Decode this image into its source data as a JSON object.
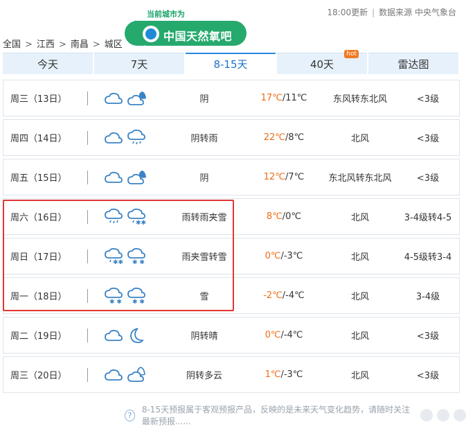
{
  "header": {
    "updated": "18:00更新",
    "source": "数据来源 中央气象台",
    "city_prefix": "当前城市为",
    "city_brand": "中国天然氧吧"
  },
  "breadcrumb": [
    "全国",
    "江西",
    "南昌",
    "城区"
  ],
  "tabs": [
    {
      "label": "今天",
      "active": false,
      "hot": false
    },
    {
      "label": "7天",
      "active": false,
      "hot": false
    },
    {
      "label": "8-15天",
      "active": true,
      "hot": false
    },
    {
      "label": "40天",
      "active": false,
      "hot": true
    },
    {
      "label": "雷达图",
      "active": false,
      "hot": false
    }
  ],
  "hot_badge": "hot",
  "forecast": [
    {
      "day": "周三（13日）",
      "icons": [
        "cloudy-icon",
        "cloudy-night-icon"
      ],
      "desc": "阴",
      "hi": "17℃",
      "lo": "/11℃",
      "wind": "东风转东北风",
      "level": "<3级"
    },
    {
      "day": "周四（14日）",
      "icons": [
        "cloudy-icon",
        "rain-icon"
      ],
      "desc": "阴转雨",
      "hi": "22℃",
      "lo": "/8℃",
      "wind": "北风",
      "level": "<3级"
    },
    {
      "day": "周五（15日）",
      "icons": [
        "cloudy-icon",
        "cloudy-night-icon"
      ],
      "desc": "阴",
      "hi": "12℃",
      "lo": "/7℃",
      "wind": "东北风转东北风",
      "level": "<3级"
    },
    {
      "day": "周六（16日）",
      "icons": [
        "rain-icon",
        "sleet-icon"
      ],
      "desc": "雨转雨夹雪",
      "hi": "8℃",
      "lo": "/0℃",
      "wind": "北风",
      "level": "3-4级转4-5"
    },
    {
      "day": "周日（17日）",
      "icons": [
        "sleet-icon",
        "snow-icon"
      ],
      "desc": "雨夹雪转雪",
      "hi": "0℃",
      "lo": "/-3℃",
      "wind": "北风",
      "level": "4-5级转3-4"
    },
    {
      "day": "周一（18日）",
      "icons": [
        "snow-icon",
        "snow-icon"
      ],
      "desc": "雪",
      "hi": "-2℃",
      "lo": "/-4℃",
      "wind": "北风",
      "level": "3-4级"
    },
    {
      "day": "周二（19日）",
      "icons": [
        "cloudy-icon",
        "moon-icon"
      ],
      "desc": "阴转晴",
      "hi": "0℃",
      "lo": "/-4℃",
      "wind": "北风",
      "level": "<3级"
    },
    {
      "day": "周三（20日）",
      "icons": [
        "cloudy-icon",
        "partly-cloudy-night-icon"
      ],
      "desc": "阴转多云",
      "hi": "1℃",
      "lo": "/-3℃",
      "wind": "北风",
      "level": "<3级"
    }
  ],
  "footer": {
    "help_icon": "?",
    "text": "8-15天预报属于客观预报产品，反映的是未来天气变化趋势，请随时关注最新预报......"
  },
  "colors": {
    "accent": "#2a86de",
    "temp_high": "#ef6c12",
    "highlight": "#e23434",
    "brand_green": "#26a96d"
  }
}
